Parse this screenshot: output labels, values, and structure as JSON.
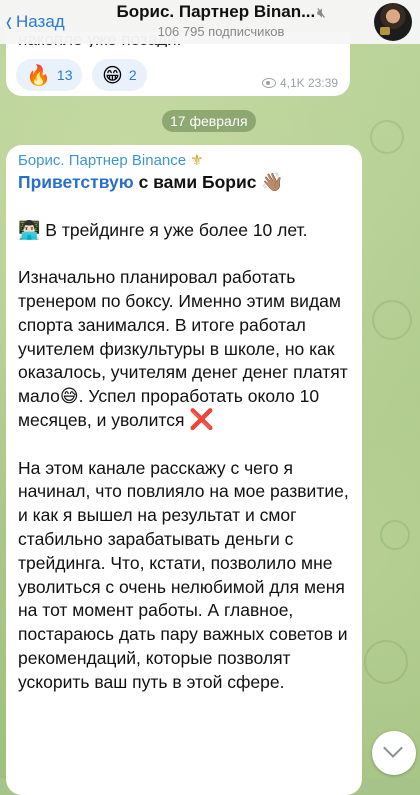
{
  "header": {
    "back_label": "Назад",
    "title": "Борис. Партнер Binan...",
    "subscribers": "106 795 подписчиков"
  },
  "prev_message": {
    "partial_text": "накопле уже позади.",
    "reactions": [
      {
        "emoji": "🔥",
        "count": "13"
      },
      {
        "emoji": "😁",
        "count": "2"
      }
    ],
    "views": "4,1K",
    "time": "23:39"
  },
  "date_separator": "17 февраля",
  "message": {
    "sender": "Борис. Партнер Binance",
    "sender_emoji": "⚜",
    "greeting_link": "Приветствую",
    "greeting_rest": " с вами Борис ",
    "greeting_emoji": "👋🏽",
    "p1_emoji": "👨🏻‍💻",
    "p1_text": " В трейдинге я уже более 10 лет.",
    "p2_text_a": "Изначально планировал работать тренером по боксу. Именно этим видам спорта занимался. В итоге работал учителем физкультуры в школе, но как оказалось, учителям денег денег  платят мало",
    "p2_emoji": "😅",
    "p2_text_b": ". Успел проработать около 10 месяцев, и уволится ",
    "p2_mark": "❌",
    "p3_text": "На этом канале расскажу с чего я начинал, что повлияло на мое развитие, и как я вышел на результат и смог стабильно зарабатывать деньги с трейдинга. Что, кстати, позволило мне уволиться с очень нелюбимой для меня на тот момент работы. А главное, постараюсь дать пару важных советов и рекомендаций, которые позволят ускорить ваш путь в этой сфере."
  },
  "icons": {
    "back": "chevron-left-icon",
    "mute": "muted-speaker-icon",
    "views": "eye-icon",
    "scroll": "chevron-down-icon"
  },
  "colors": {
    "accent": "#2a7ad6",
    "sender": "#3e95d6",
    "chat_background": "#a6c48a"
  }
}
